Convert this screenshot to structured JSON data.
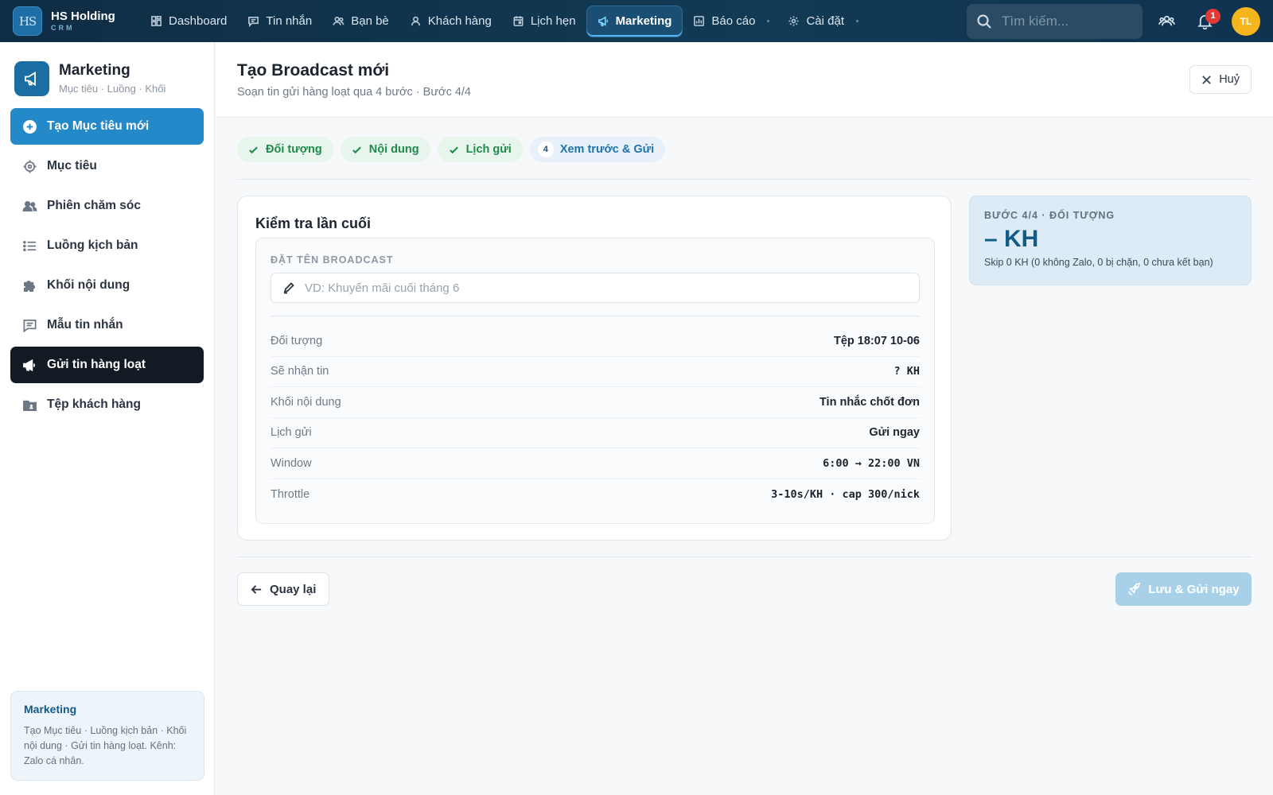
{
  "brand": {
    "logo": "HS",
    "name": "HS Holding",
    "sub": "CRM"
  },
  "nav": {
    "items": [
      {
        "label": "Dashboard",
        "icon": "grid-icon"
      },
      {
        "label": "Tin nhắn",
        "icon": "message-icon"
      },
      {
        "label": "Bạn bè",
        "icon": "friends-icon"
      },
      {
        "label": "Khách hàng",
        "icon": "user-icon"
      },
      {
        "label": "Lịch hẹn",
        "icon": "calendar-icon"
      },
      {
        "label": "Marketing",
        "icon": "megaphone-icon",
        "active": true
      },
      {
        "label": "Báo cáo",
        "icon": "chart-icon"
      },
      {
        "label": "Cài đặt",
        "icon": "gear-icon"
      }
    ],
    "search_placeholder": "Tìm kiếm...",
    "notification_count": "1",
    "avatar_initials": "TL"
  },
  "sidebar": {
    "title": "Marketing",
    "subtitle": "Mục tiêu · Luồng · Khối",
    "items": [
      {
        "label": "Tạo Mục tiêu mới",
        "icon": "plus-circle-icon"
      },
      {
        "label": "Mục tiêu",
        "icon": "target-icon"
      },
      {
        "label": "Phiên chăm sóc",
        "icon": "people-icon"
      },
      {
        "label": "Luồng kịch bản",
        "icon": "list-icon"
      },
      {
        "label": "Khối nội dung",
        "icon": "puzzle-icon"
      },
      {
        "label": "Mẫu tin nhắn",
        "icon": "message-icon"
      },
      {
        "label": "Gửi tin hàng loạt",
        "icon": "megaphone-icon"
      },
      {
        "label": "Tệp khách hàng",
        "icon": "folder-user-icon"
      }
    ],
    "info": {
      "title": "Marketing",
      "text": "Tạo Mục tiêu · Luồng kịch bản · Khối nội dung · Gửi tin hàng loạt. Kênh: Zalo cá nhân."
    }
  },
  "page": {
    "title": "Tạo Broadcast mới",
    "subtitle": "Soạn tin gửi hàng loạt qua 4 bước · Bước 4/4",
    "cancel_label": "Huỷ"
  },
  "steps": [
    {
      "label": "Đối tượng",
      "done": true
    },
    {
      "label": "Nội dung",
      "done": true
    },
    {
      "label": "Lịch gửi",
      "done": true
    },
    {
      "label": "Xem trước & Gửi",
      "number": "4",
      "current": true
    }
  ],
  "review": {
    "title": "Kiểm tra lần cuối",
    "name_label": "ĐẶT TÊN BROADCAST",
    "name_placeholder": "VD: Khuyến mãi cuối tháng 6",
    "rows": [
      {
        "label": "Đối tượng",
        "value": "Tệp 18:07 10-06",
        "mono": false
      },
      {
        "label": "Sẽ nhận tin",
        "value": "? KH",
        "mono": true
      },
      {
        "label": "Khối nội dung",
        "value": "Tin nhắc chốt đơn",
        "mono": false
      },
      {
        "label": "Lịch gửi",
        "value": "Gửi ngay",
        "mono": false
      },
      {
        "label": "Window",
        "value": "6:00 → 22:00 VN",
        "mono": true
      },
      {
        "label": "Throttle",
        "value": "3-10s/KH · cap 300/nick",
        "mono": true
      }
    ]
  },
  "summary": {
    "label": "BƯỚC 4/4 · ĐỐI TƯỢNG",
    "value": "– KH",
    "note": "Skip 0 KH (0 không Zalo, 0 bị chặn, 0 chưa kết bạn)"
  },
  "actions": {
    "back_label": "Quay lại",
    "send_label": "Lưu & Gửi ngay"
  }
}
